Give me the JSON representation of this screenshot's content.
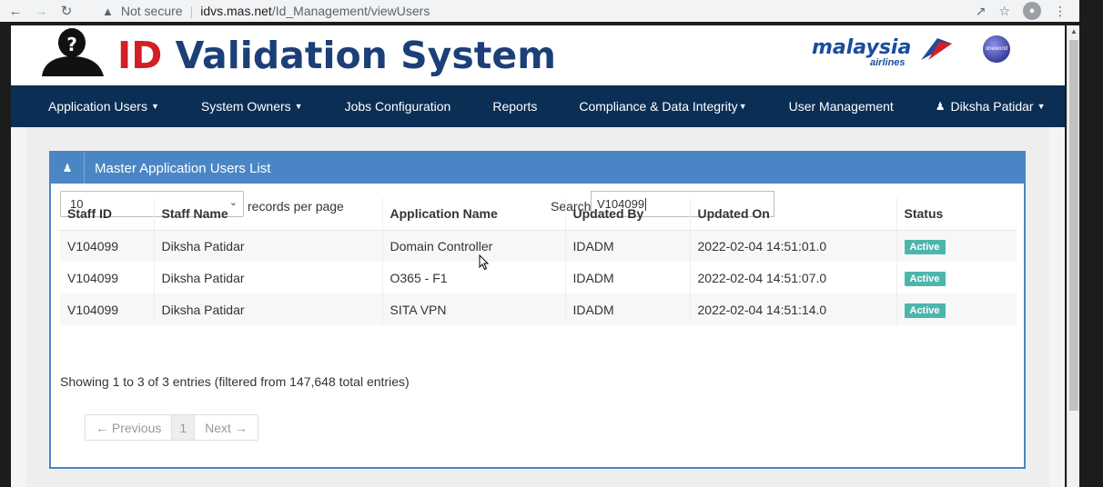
{
  "browser": {
    "back_icon": "arrow-left-icon",
    "forward_icon": "arrow-right-icon",
    "reload_icon": "reload-icon",
    "security_label": "Not secure",
    "url_host": "idvs.mas.net",
    "url_path": "/Id_Management/viewUsers"
  },
  "header": {
    "title_prefix": "ID",
    "title_rest": " Validation System",
    "airline_word": "malaysia",
    "airline_sub": "airlines",
    "oneworld_label": "oneworld"
  },
  "navbar": {
    "items": [
      {
        "label": "Application Users",
        "dropdown": true
      },
      {
        "label": "System Owners",
        "dropdown": true
      },
      {
        "label": "Jobs Configuration",
        "dropdown": false
      },
      {
        "label": "Reports",
        "dropdown": false
      },
      {
        "label": "Compliance & Data Integrity",
        "dropdown": true
      },
      {
        "label": "User Management",
        "dropdown": false
      },
      {
        "label": "Diksha Patidar",
        "dropdown": true
      }
    ]
  },
  "panel": {
    "title": "Master Application Users List",
    "length_value": "10",
    "length_label": "records per page",
    "search_label": "Search:",
    "search_value": "V104099",
    "columns": [
      "Staff ID",
      "Staff Name",
      "Application Name",
      "Updated By",
      "Updated On",
      "Status"
    ],
    "rows": [
      {
        "staff_id": "V104099",
        "staff_name": "Diksha Patidar",
        "application": "Domain Controller",
        "updated_by": "IDADM",
        "updated_on": "2022-02-04 14:51:01.0",
        "status": "Active"
      },
      {
        "staff_id": "V104099",
        "staff_name": "Diksha Patidar",
        "application": "O365 - F1",
        "updated_by": "IDADM",
        "updated_on": "2022-02-04 14:51:07.0",
        "status": "Active"
      },
      {
        "staff_id": "V104099",
        "staff_name": "Diksha Patidar",
        "application": "SITA VPN",
        "updated_by": "IDADM",
        "updated_on": "2022-02-04 14:51:14.0",
        "status": "Active"
      }
    ],
    "info": "Showing 1 to 3 of 3 entries (filtered from 147,648 total entries)",
    "pager": {
      "previous": "← Previous",
      "page": "1",
      "next": "Next →"
    }
  },
  "colors": {
    "navbar": "#0b2e55",
    "panel_header": "#4a86c5",
    "badge_active": "#4db6ac",
    "title_red": "#d21f26",
    "title_blue": "#1c3f77"
  }
}
